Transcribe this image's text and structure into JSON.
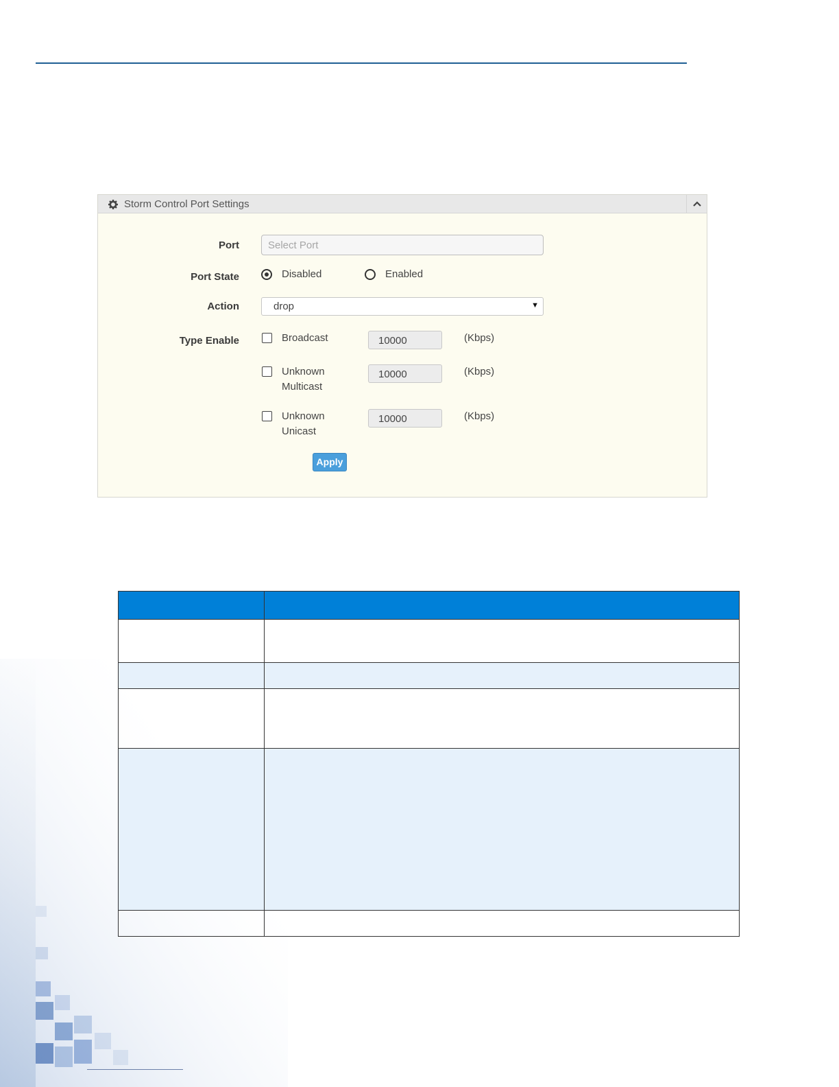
{
  "panel": {
    "title": "Storm Control Port Settings",
    "icon": "gear-icon",
    "collapse_icon": "chevron-up-icon"
  },
  "form": {
    "port_label": "Port",
    "port_placeholder": "Select Port",
    "port_state_label": "Port State",
    "port_state_options": [
      "Disabled",
      "Enabled"
    ],
    "port_state_selected": "Disabled",
    "action_label": "Action",
    "action_value": "drop",
    "type_enable_label": "Type Enable",
    "types": [
      {
        "name_line1": "Broadcast",
        "name_line2": "",
        "rate": "10000",
        "unit": "(Kbps)",
        "checked": false
      },
      {
        "name_line1": "Unknown",
        "name_line2": "Multicast",
        "rate": "10000",
        "unit": "(Kbps)",
        "checked": false
      },
      {
        "name_line1": "Unknown",
        "name_line2": "Unicast",
        "rate": "10000",
        "unit": "(Kbps)",
        "checked": false
      }
    ],
    "apply_label": "Apply"
  },
  "colors": {
    "header_rule": "#1f5f94",
    "table_header": "#0080d8",
    "table_alt_row": "#e6f1fb",
    "apply_button": "#4a9fdc"
  }
}
